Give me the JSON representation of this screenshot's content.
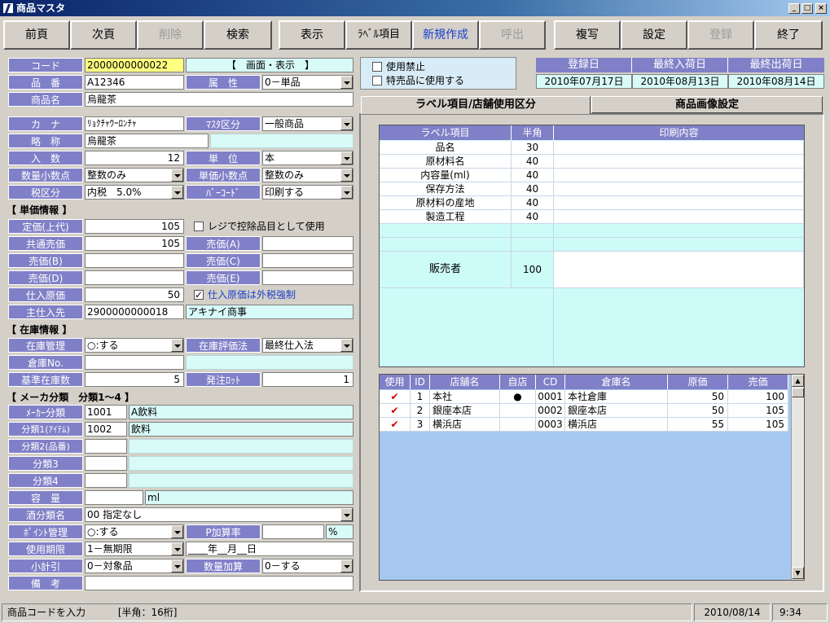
{
  "window": {
    "title": "商品マスタ",
    "min_label": "_",
    "max_label": "□",
    "close_label": "×"
  },
  "toolbar": {
    "prev": "前頁",
    "next": "次頁",
    "delete": "削除",
    "search": "検索",
    "display": "表示",
    "label_item": "ﾗﾍﾞﾙ項目",
    "new": "新規作成",
    "call": "呼出",
    "copy": "複写",
    "settings": "設定",
    "register": "登録",
    "exit": "終了"
  },
  "form": {
    "code": {
      "label": "コード",
      "value": "2000000000022"
    },
    "screen_display": "【　画面・表示　】",
    "hinban": {
      "label": "品　番",
      "value": "A12346"
    },
    "zokusei": {
      "label": "属　性",
      "value": "0－単品"
    },
    "shohinmei": {
      "label": "商品名",
      "value": "烏龍茶"
    },
    "kana": {
      "label": "カ　ナ",
      "value": "ﾘｮｸﾁｬｳｰﾛﾝﾁｬ"
    },
    "master_kubun": {
      "label": "ﾏｽﾀ区分",
      "value": "一般商品"
    },
    "ryakusho": {
      "label": "略　称",
      "value": "烏龍茶"
    },
    "irisu": {
      "label": "入　数",
      "value": "12"
    },
    "tani": {
      "label": "単　位",
      "value": "本"
    },
    "suryo_shosu": {
      "label": "数量小数点",
      "value": "整数のみ"
    },
    "tanka_shosu": {
      "label": "単価小数点",
      "value": "整数のみ"
    },
    "zeikubun": {
      "label": "税区分",
      "value": "内税　5.0%"
    },
    "barcode": {
      "label": "ﾊﾞｰｺｰﾄﾞ",
      "value": "印刷する"
    },
    "section_price": "【 単価情報 】",
    "teika": {
      "label": "定価(上代)",
      "value": "105"
    },
    "register_check": "レジで控除品目として使用",
    "kyotsu_baika": {
      "label": "共通売価",
      "value": "105"
    },
    "baika_a": {
      "label": "売価(A)",
      "value": ""
    },
    "baika_b": {
      "label": "売価(B)",
      "value": ""
    },
    "baika_c": {
      "label": "売価(C)",
      "value": ""
    },
    "baika_d": {
      "label": "売価(D)",
      "value": ""
    },
    "baika_e": {
      "label": "売価(E)",
      "value": ""
    },
    "shiire_genka": {
      "label": "仕入原価",
      "value": "50"
    },
    "soto_zei_check": "仕入原価は外税強制",
    "shu_shiiresaki": {
      "label": "主仕入先",
      "value": "2900000000018",
      "name": "アキナイ商事"
    },
    "section_stock": "【 在庫情報 】",
    "zaiko_kanri": {
      "label": "在庫管理",
      "value": "○:する"
    },
    "zaiko_hyoka": {
      "label": "在庫評価法",
      "value": "最終仕入法"
    },
    "soko_no": {
      "label": "倉庫No.",
      "value": ""
    },
    "kijun_zaiko": {
      "label": "基準在庫数",
      "value": "5"
    },
    "hatchu_lot": {
      "label": "発注ﾛｯﾄ",
      "value": "1"
    },
    "section_maker": "【 メーカ分類　分類1～4 】",
    "maker_bunrui": {
      "label": "ﾒｰｶｰ分類",
      "value": "1001",
      "name": "A飲料"
    },
    "bunrui1": {
      "label": "分類1(ｱｲﾃﾑ)",
      "value": "1002",
      "name": "飲料"
    },
    "bunrui2": {
      "label": "分類2(品番)",
      "value": ""
    },
    "bunrui3": {
      "label": "分類3",
      "value": ""
    },
    "bunrui4": {
      "label": "分類4",
      "value": ""
    },
    "yoryo": {
      "label": "容　量",
      "value": "",
      "unit": "ml"
    },
    "sake_bunrui": {
      "label": "酒分類名",
      "value": "00 指定なし"
    },
    "point_kanri": {
      "label": "ﾎﾟｲﾝﾄ管理",
      "value": "○:する"
    },
    "p_kasanritsu": {
      "label": "P加算率",
      "value": "",
      "unit": "%"
    },
    "shiyo_kigen": {
      "label": "使用期限",
      "value": "1－無期限",
      "date": "____年__月__日"
    },
    "shokei": {
      "label": "小計引",
      "value": "0－対象品"
    },
    "suryo_kasan": {
      "label": "数量加算",
      "value": "0－する"
    },
    "biko": {
      "label": "備　考",
      "value": ""
    }
  },
  "flags": {
    "shiyo_kinshi": "使用禁止",
    "tokubai": "特売品に使用する"
  },
  "dates": {
    "headers": [
      "登録日",
      "最終入荷日",
      "最終出荷日"
    ],
    "values": [
      "2010年07月17日",
      "2010年08月13日",
      "2010年08月14日"
    ]
  },
  "tabs": {
    "label_tab": "ラベル項目/店舗使用区分",
    "image_tab": "商品画像設定"
  },
  "label_table": {
    "headers": [
      "ラベル項目",
      "半角",
      "印刷内容"
    ],
    "rows": [
      {
        "item": "品名",
        "width": "30",
        "content": ""
      },
      {
        "item": "原材料名",
        "width": "40",
        "content": ""
      },
      {
        "item": "内容量(ml)",
        "width": "40",
        "content": ""
      },
      {
        "item": "保存方法",
        "width": "40",
        "content": ""
      },
      {
        "item": "原材料の産地",
        "width": "40",
        "content": ""
      },
      {
        "item": "製造工程",
        "width": "40",
        "content": ""
      }
    ],
    "seller": {
      "item": "販売者",
      "width": "100"
    }
  },
  "store_table": {
    "headers": [
      "使用",
      "ID",
      "店舗名",
      "自店",
      "CD",
      "倉庫名",
      "原価",
      "売価"
    ],
    "rows": [
      {
        "use": "✔",
        "id": "1",
        "store": "本社",
        "own": "●",
        "cd": "0001",
        "warehouse": "本社倉庫",
        "cost": "50",
        "price": "100"
      },
      {
        "use": "✔",
        "id": "2",
        "store": "銀座本店",
        "own": "",
        "cd": "0002",
        "warehouse": "銀座本店",
        "cost": "50",
        "price": "105"
      },
      {
        "use": "✔",
        "id": "3",
        "store": "横浜店",
        "own": "",
        "cd": "0003",
        "warehouse": "横浜店",
        "cost": "55",
        "price": "105"
      }
    ]
  },
  "status": {
    "message": "商品コードを入力",
    "hint": "[半角：16桁]",
    "date": "2010/08/14",
    "time": "9:34"
  }
}
